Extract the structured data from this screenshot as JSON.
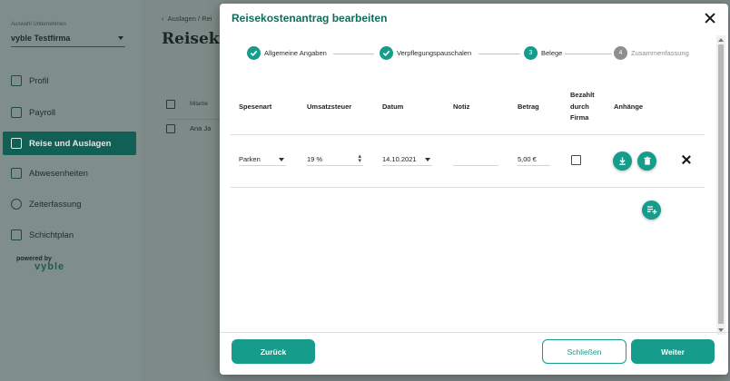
{
  "colors": {
    "accent": "#169c8a",
    "title": "#0f6b5f",
    "sidebar_active": "#125f55"
  },
  "sidebar": {
    "company_label": "Auswahl Unternehmen",
    "company_value": "vyble Testfirma",
    "items": [
      {
        "label": "Profil",
        "icon": "profile-icon"
      },
      {
        "label": "Payroll",
        "icon": "payroll-icon"
      },
      {
        "label": "Reise und Auslagen",
        "icon": "travel-icon",
        "active": true
      },
      {
        "label": "Abwesenheiten",
        "icon": "calendar-icon"
      },
      {
        "label": "Zeiterfassung",
        "icon": "stopwatch-icon"
      },
      {
        "label": "Schichtplan",
        "icon": "shift-plan-icon"
      }
    ],
    "powered_by": "powered by",
    "brand": "vyble"
  },
  "background": {
    "breadcrumb": "Auslagen / Rei",
    "title": "Reiseko",
    "table_header": "Mitarbe",
    "row_name": "Ana Ja"
  },
  "modal": {
    "title": "Reisekostenantrag bearbeiten",
    "steps": [
      {
        "label": "Allgemeine Angaben",
        "state": "done"
      },
      {
        "label": "Verpflegungspauschalen",
        "state": "done"
      },
      {
        "number": "3",
        "label": "Belege",
        "state": "active"
      },
      {
        "number": "4",
        "label": "Zusammenfassung",
        "state": "pending"
      }
    ],
    "columns": {
      "spesenart": "Spesenart",
      "umsatzsteuer": "Umsatzsteuer",
      "datum": "Datum",
      "notiz": "Notiz",
      "betrag": "Betrag",
      "bezahlt_line1": "Bezahlt",
      "bezahlt_line2": "durch",
      "bezahlt_line3": "Firma",
      "anhaenge": "Anhänge"
    },
    "row": {
      "spesenart": "Parken",
      "umsatzsteuer": "19 %",
      "datum": "14.10.2021",
      "notiz": "",
      "betrag": "5,00 €",
      "bezahlt": false
    },
    "buttons": {
      "back": "Zurück",
      "close": "Schließen",
      "next": "Weiter"
    }
  }
}
